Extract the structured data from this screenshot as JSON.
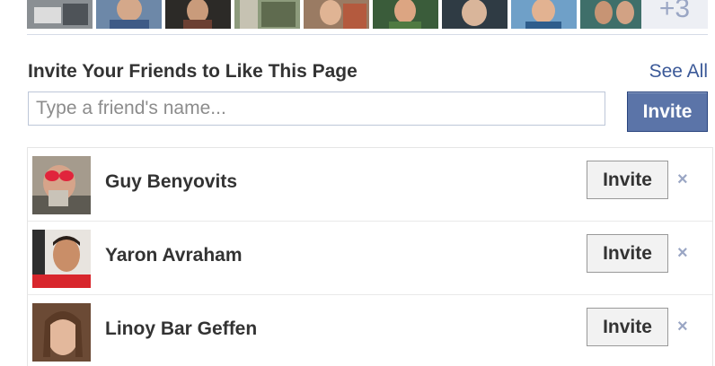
{
  "header_strip": {
    "more_count": "+3"
  },
  "invite_section": {
    "title": "Invite Your Friends to Like This Page",
    "see_all": "See All",
    "search_placeholder": "Type a friend's name...",
    "invite_button": "Invite"
  },
  "friends": [
    {
      "name": "Guy Benyovits",
      "invite_label": "Invite",
      "remove_label": "×"
    },
    {
      "name": "Yaron Avraham",
      "invite_label": "Invite",
      "remove_label": "×"
    },
    {
      "name": "Linoy Bar Geffen",
      "invite_label": "Invite",
      "remove_label": "×"
    }
  ],
  "colors": {
    "link": "#3b5998",
    "primary_button": "#5b74a8",
    "text": "#333333"
  }
}
